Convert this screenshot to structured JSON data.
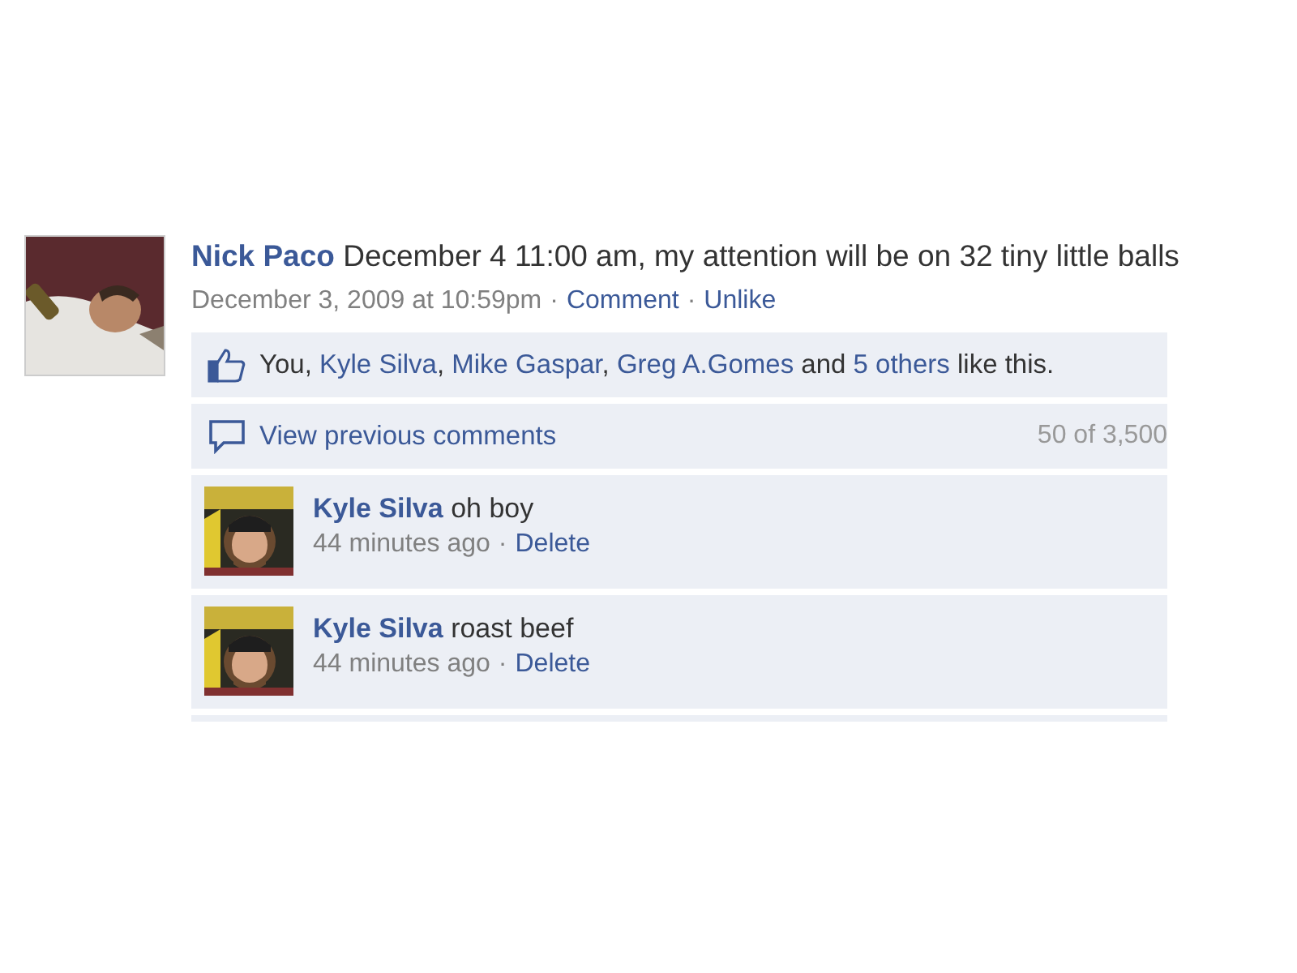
{
  "post": {
    "author": "Nick Paco",
    "message": "December 4 11:00 am, my attention will be on 32 tiny little balls",
    "time": "December 3, 2009 at 10:59pm",
    "separator": "·",
    "actions": [
      "Comment",
      "Unlike"
    ],
    "likes": [
      {
        "kind": "text",
        "text": "You, "
      },
      {
        "kind": "link",
        "text": "Kyle Silva"
      },
      {
        "kind": "text",
        "text": ", "
      },
      {
        "kind": "link",
        "text": "Mike Gaspar"
      },
      {
        "kind": "text",
        "text": ", "
      },
      {
        "kind": "link",
        "text": "Greg A.Gomes"
      },
      {
        "kind": "text",
        "text": " and "
      },
      {
        "kind": "link",
        "text": "5 others"
      },
      {
        "kind": "text",
        "text": " like this."
      }
    ],
    "view_previous": {
      "label": "View previous comments",
      "count": "50 of 3,500"
    },
    "comments": [
      {
        "author": "Kyle Silva",
        "text": "oh boy",
        "time": "44 minutes ago",
        "action": "Delete"
      },
      {
        "author": "Kyle Silva",
        "text": "roast beef",
        "time": "44 minutes ago",
        "action": "Delete"
      }
    ]
  }
}
